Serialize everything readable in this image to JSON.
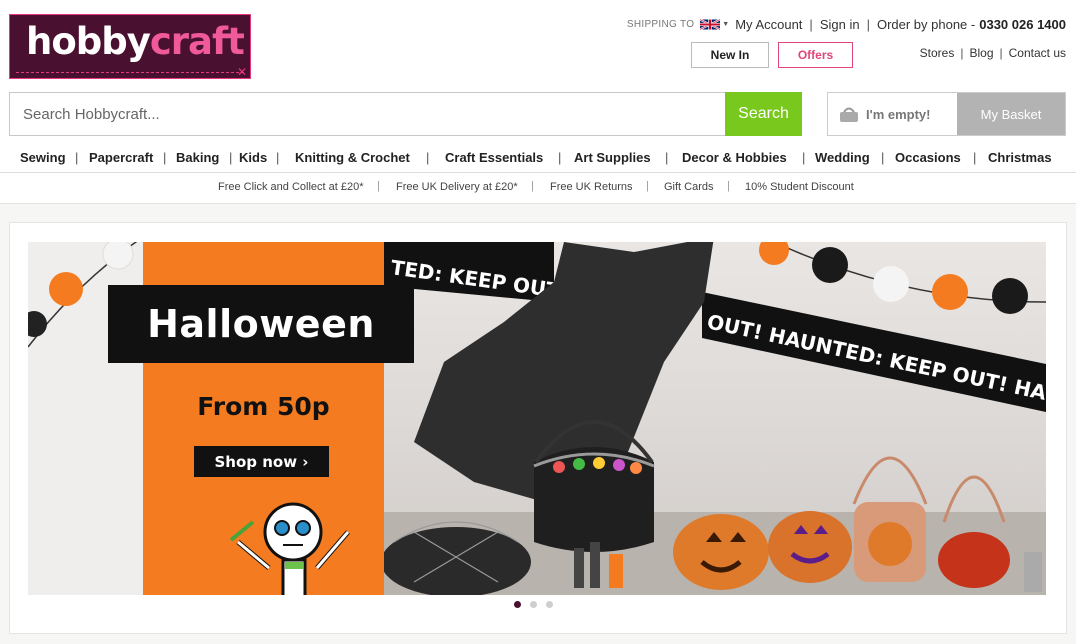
{
  "brand": {
    "logo_part1": "hobby",
    "logo_part2": "craft"
  },
  "utility": {
    "shipping_label": "SHIPPING TO",
    "my_account": "My Account",
    "sign_in": "Sign in",
    "order_by_phone": "Order by phone -",
    "phone": "0330 026 1400",
    "separator": "|"
  },
  "quick_buttons": {
    "new_in": "New In",
    "offers": "Offers"
  },
  "top_links": [
    "Stores",
    "Blog",
    "Contact us"
  ],
  "search": {
    "placeholder": "Search Hobbycraft...",
    "button": "Search"
  },
  "basket": {
    "status": "I'm empty!",
    "button": "My Basket"
  },
  "main_nav": [
    "Sewing",
    "Papercraft",
    "Baking",
    "Kids",
    "Knitting & Crochet",
    "Craft Essentials",
    "Art Supplies",
    "Decor & Hobbies",
    "Wedding",
    "Occasions",
    "Christmas"
  ],
  "usp": [
    "Free Click and Collect at £20*",
    "Free UK Delivery at £20*",
    "Free UK Returns",
    "Gift Cards",
    "10% Student Discount"
  ],
  "hero": {
    "title": "Halloween",
    "subtitle": "From 50p",
    "cta": "Shop now ›",
    "banner_text_1": "TED: KEEP OUT!",
    "banner_text_2": "OUT! HAUNTED: KEEP OUT! HAUNTE"
  },
  "carousel": {
    "slides": 3,
    "active_index": 0
  },
  "colors": {
    "brand_purple": "#4a1030",
    "brand_pink": "#e8377f",
    "search_green": "#78c81e",
    "hero_orange": "#f47b20"
  }
}
